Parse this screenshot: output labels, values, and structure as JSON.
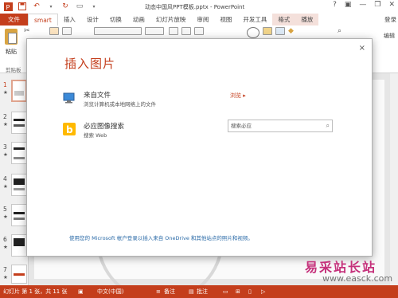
{
  "window": {
    "title": "动态中国风PPT模板.pptx - PowerPoint",
    "controls": [
      "?",
      "▣",
      "—",
      "❐",
      "✕"
    ]
  },
  "ribbon": {
    "tabs": [
      {
        "label": "文件",
        "kind": "file"
      },
      {
        "label": "smart",
        "kind": "active"
      },
      {
        "label": "插入",
        "kind": "normal"
      },
      {
        "label": "设计",
        "kind": "normal"
      },
      {
        "label": "切换",
        "kind": "normal"
      },
      {
        "label": "动画",
        "kind": "normal"
      },
      {
        "label": "幻灯片放映",
        "kind": "normal"
      },
      {
        "label": "审阅",
        "kind": "normal"
      },
      {
        "label": "视图",
        "kind": "normal"
      },
      {
        "label": "开发工具",
        "kind": "normal"
      },
      {
        "label": "格式",
        "kind": "ctx"
      },
      {
        "label": "播放",
        "kind": "ctx"
      }
    ],
    "login": "登录",
    "paste_label": "粘贴",
    "clipboard_label": "剪贴板",
    "editing_label": "编辑"
  },
  "thumbnails": [
    {
      "num": "1",
      "selected": true
    },
    {
      "num": "2",
      "selected": false
    },
    {
      "num": "3",
      "selected": false
    },
    {
      "num": "4",
      "selected": false
    },
    {
      "num": "5",
      "selected": false
    },
    {
      "num": "6",
      "selected": false
    },
    {
      "num": "7",
      "selected": false
    }
  ],
  "dialog": {
    "title": "插入图片",
    "close": "×",
    "from_file": {
      "title": "来自文件",
      "subtitle": "浏览计算机或本地网络上的文件",
      "action": "浏览 ▸"
    },
    "bing": {
      "title": "必应图像搜索",
      "subtitle": "搜索 Web",
      "placeholder": "搜索必应"
    },
    "footer": "使用您的 Microsoft 帐户登录以插入来自 OneDrive 和其他站点的照片和视频。"
  },
  "status": {
    "slide_info": "幻灯片 第 1 张，共 11 张",
    "language": "中文(中国)",
    "notes": "备注",
    "comments": "批注"
  },
  "watermark": {
    "cn": "易采站长站",
    "url": "www.easck.com"
  },
  "colors": {
    "accent": "#c43e1c",
    "link": "#2a6aa7",
    "bing": "#ffb900"
  }
}
